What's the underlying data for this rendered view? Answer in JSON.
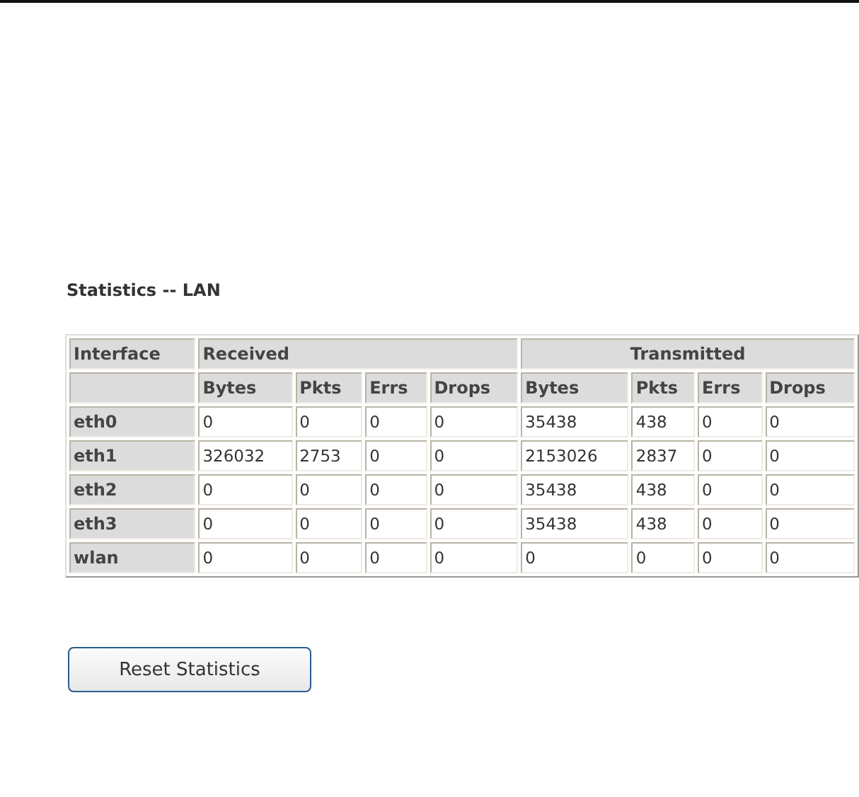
{
  "title": "Statistics -- LAN",
  "table": {
    "interface_header": "Interface",
    "column_groups": [
      {
        "label": "Received",
        "columns": [
          "Bytes",
          "Pkts",
          "Errs",
          "Drops"
        ]
      },
      {
        "label": "Transmitted",
        "columns": [
          "Bytes",
          "Pkts",
          "Errs",
          "Drops"
        ]
      }
    ],
    "rows": [
      {
        "interface": "eth0",
        "cells": [
          "0",
          "0",
          "0",
          "0",
          "35438",
          "438",
          "0",
          "0"
        ]
      },
      {
        "interface": "eth1",
        "cells": [
          "326032",
          "2753",
          "0",
          "0",
          "2153026",
          "2837",
          "0",
          "0"
        ]
      },
      {
        "interface": "eth2",
        "cells": [
          "0",
          "0",
          "0",
          "0",
          "35438",
          "438",
          "0",
          "0"
        ]
      },
      {
        "interface": "eth3",
        "cells": [
          "0",
          "0",
          "0",
          "0",
          "35438",
          "438",
          "0",
          "0"
        ]
      },
      {
        "interface": "wlan",
        "cells": [
          "0",
          "0",
          "0",
          "0",
          "0",
          "0",
          "0",
          "0"
        ]
      }
    ]
  },
  "buttons": [
    "Reset Statistics"
  ]
}
